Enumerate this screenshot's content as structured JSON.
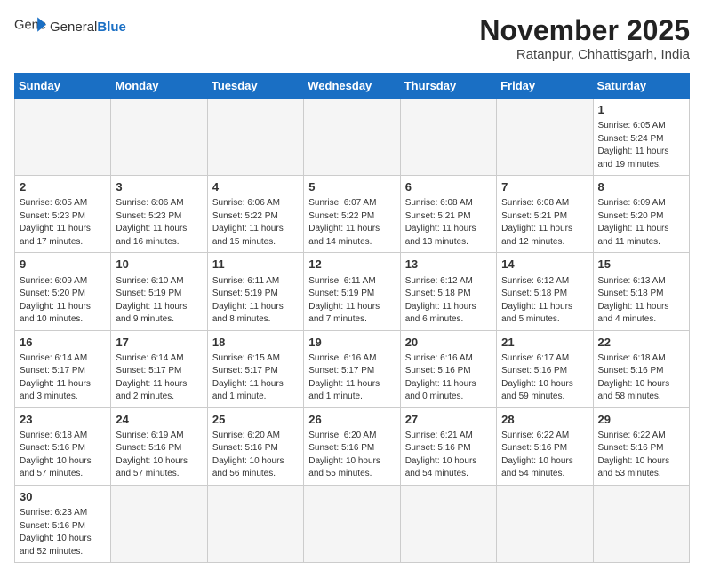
{
  "header": {
    "logo_general": "General",
    "logo_blue": "Blue",
    "month_title": "November 2025",
    "subtitle": "Ratanpur, Chhattisgarh, India"
  },
  "days_of_week": [
    "Sunday",
    "Monday",
    "Tuesday",
    "Wednesday",
    "Thursday",
    "Friday",
    "Saturday"
  ],
  "weeks": [
    [
      {
        "day": "",
        "info": ""
      },
      {
        "day": "",
        "info": ""
      },
      {
        "day": "",
        "info": ""
      },
      {
        "day": "",
        "info": ""
      },
      {
        "day": "",
        "info": ""
      },
      {
        "day": "",
        "info": ""
      },
      {
        "day": "1",
        "info": "Sunrise: 6:05 AM\nSunset: 5:24 PM\nDaylight: 11 hours and 19 minutes."
      }
    ],
    [
      {
        "day": "2",
        "info": "Sunrise: 6:05 AM\nSunset: 5:23 PM\nDaylight: 11 hours and 17 minutes."
      },
      {
        "day": "3",
        "info": "Sunrise: 6:06 AM\nSunset: 5:23 PM\nDaylight: 11 hours and 16 minutes."
      },
      {
        "day": "4",
        "info": "Sunrise: 6:06 AM\nSunset: 5:22 PM\nDaylight: 11 hours and 15 minutes."
      },
      {
        "day": "5",
        "info": "Sunrise: 6:07 AM\nSunset: 5:22 PM\nDaylight: 11 hours and 14 minutes."
      },
      {
        "day": "6",
        "info": "Sunrise: 6:08 AM\nSunset: 5:21 PM\nDaylight: 11 hours and 13 minutes."
      },
      {
        "day": "7",
        "info": "Sunrise: 6:08 AM\nSunset: 5:21 PM\nDaylight: 11 hours and 12 minutes."
      },
      {
        "day": "8",
        "info": "Sunrise: 6:09 AM\nSunset: 5:20 PM\nDaylight: 11 hours and 11 minutes."
      }
    ],
    [
      {
        "day": "9",
        "info": "Sunrise: 6:09 AM\nSunset: 5:20 PM\nDaylight: 11 hours and 10 minutes."
      },
      {
        "day": "10",
        "info": "Sunrise: 6:10 AM\nSunset: 5:19 PM\nDaylight: 11 hours and 9 minutes."
      },
      {
        "day": "11",
        "info": "Sunrise: 6:11 AM\nSunset: 5:19 PM\nDaylight: 11 hours and 8 minutes."
      },
      {
        "day": "12",
        "info": "Sunrise: 6:11 AM\nSunset: 5:19 PM\nDaylight: 11 hours and 7 minutes."
      },
      {
        "day": "13",
        "info": "Sunrise: 6:12 AM\nSunset: 5:18 PM\nDaylight: 11 hours and 6 minutes."
      },
      {
        "day": "14",
        "info": "Sunrise: 6:12 AM\nSunset: 5:18 PM\nDaylight: 11 hours and 5 minutes."
      },
      {
        "day": "15",
        "info": "Sunrise: 6:13 AM\nSunset: 5:18 PM\nDaylight: 11 hours and 4 minutes."
      }
    ],
    [
      {
        "day": "16",
        "info": "Sunrise: 6:14 AM\nSunset: 5:17 PM\nDaylight: 11 hours and 3 minutes."
      },
      {
        "day": "17",
        "info": "Sunrise: 6:14 AM\nSunset: 5:17 PM\nDaylight: 11 hours and 2 minutes."
      },
      {
        "day": "18",
        "info": "Sunrise: 6:15 AM\nSunset: 5:17 PM\nDaylight: 11 hours and 1 minute."
      },
      {
        "day": "19",
        "info": "Sunrise: 6:16 AM\nSunset: 5:17 PM\nDaylight: 11 hours and 1 minute."
      },
      {
        "day": "20",
        "info": "Sunrise: 6:16 AM\nSunset: 5:16 PM\nDaylight: 11 hours and 0 minutes."
      },
      {
        "day": "21",
        "info": "Sunrise: 6:17 AM\nSunset: 5:16 PM\nDaylight: 10 hours and 59 minutes."
      },
      {
        "day": "22",
        "info": "Sunrise: 6:18 AM\nSunset: 5:16 PM\nDaylight: 10 hours and 58 minutes."
      }
    ],
    [
      {
        "day": "23",
        "info": "Sunrise: 6:18 AM\nSunset: 5:16 PM\nDaylight: 10 hours and 57 minutes."
      },
      {
        "day": "24",
        "info": "Sunrise: 6:19 AM\nSunset: 5:16 PM\nDaylight: 10 hours and 57 minutes."
      },
      {
        "day": "25",
        "info": "Sunrise: 6:20 AM\nSunset: 5:16 PM\nDaylight: 10 hours and 56 minutes."
      },
      {
        "day": "26",
        "info": "Sunrise: 6:20 AM\nSunset: 5:16 PM\nDaylight: 10 hours and 55 minutes."
      },
      {
        "day": "27",
        "info": "Sunrise: 6:21 AM\nSunset: 5:16 PM\nDaylight: 10 hours and 54 minutes."
      },
      {
        "day": "28",
        "info": "Sunrise: 6:22 AM\nSunset: 5:16 PM\nDaylight: 10 hours and 54 minutes."
      },
      {
        "day": "29",
        "info": "Sunrise: 6:22 AM\nSunset: 5:16 PM\nDaylight: 10 hours and 53 minutes."
      }
    ],
    [
      {
        "day": "30",
        "info": "Sunrise: 6:23 AM\nSunset: 5:16 PM\nDaylight: 10 hours and 52 minutes."
      },
      {
        "day": "",
        "info": ""
      },
      {
        "day": "",
        "info": ""
      },
      {
        "day": "",
        "info": ""
      },
      {
        "day": "",
        "info": ""
      },
      {
        "day": "",
        "info": ""
      },
      {
        "day": "",
        "info": ""
      }
    ]
  ]
}
